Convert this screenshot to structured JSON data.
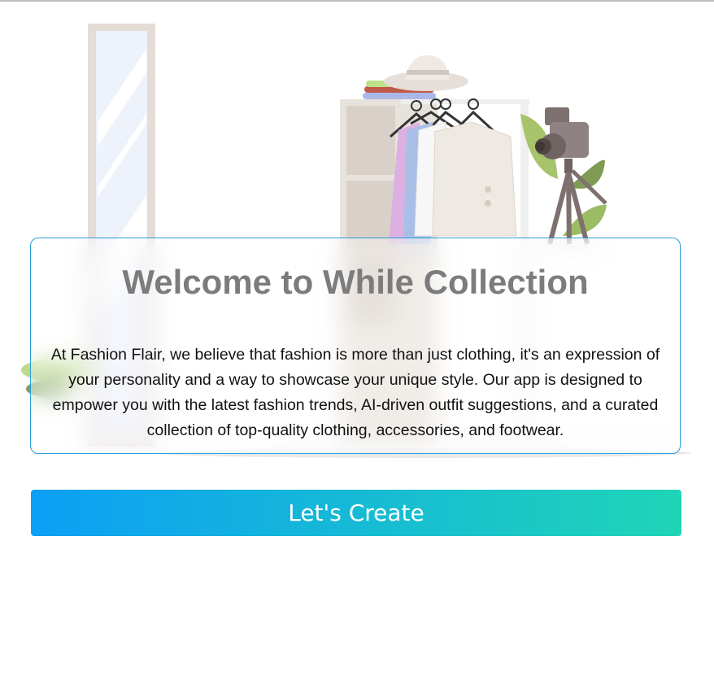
{
  "welcome": {
    "title": "Welcome to While Collection",
    "description": "At Fashion Flair, we believe that fashion is more than just clothing, it's an expression of your personality and a way to showcase your unique style. Our app is designed to empower you with the latest fashion trends, AI-driven outfit suggestions, and a curated collection of top-quality clothing, accessories, and footwear."
  },
  "cta": {
    "label": "Let's Create"
  },
  "illustration": {
    "items": [
      "mirror-illustration",
      "hat-illustration",
      "clothing-rack-illustration",
      "camera-tripod-illustration",
      "plant-illustration"
    ]
  },
  "colors": {
    "card_border": "#2a9fd8",
    "title": "#7c7c7c",
    "cta_gradient_start": "#0d9ff5",
    "cta_gradient_end": "#1fd5b6"
  }
}
